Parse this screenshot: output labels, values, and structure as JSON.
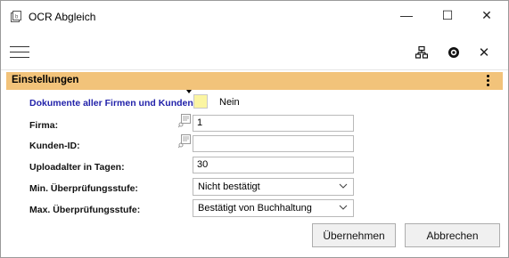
{
  "window": {
    "title": "OCR Abgleich",
    "minimize_symbol": "—",
    "maximize_symbol": "☐",
    "close_symbol": "✕"
  },
  "toolbar": {
    "close_symbol": "✕",
    "icons": [
      "menu-icon",
      "layout-icon",
      "help-icon",
      "close-icon"
    ]
  },
  "section": {
    "title": "Einstellungen"
  },
  "form": {
    "all_docs": {
      "label": "Dokumente aller Firmen und Kunden:",
      "value": "Nein",
      "color": "#fbf5a2"
    },
    "firma": {
      "label": "Firma:",
      "value": "1"
    },
    "kunden_id": {
      "label": "Kunden-ID:",
      "value": ""
    },
    "uploadalter": {
      "label": "Uploadalter in Tagen:",
      "value": "30"
    },
    "min_stufe": {
      "label": "Min. Überprüfungsstufe:",
      "value": "Nicht bestätigt"
    },
    "max_stufe": {
      "label": "Max. Überprüfungsstufe:",
      "value": "Bestätigt von Buchhaltung"
    }
  },
  "buttons": {
    "apply": "Übernehmen",
    "cancel": "Abbrechen"
  },
  "colors": {
    "section_header": "#f2c37a",
    "label_accent": "#2222aa"
  }
}
